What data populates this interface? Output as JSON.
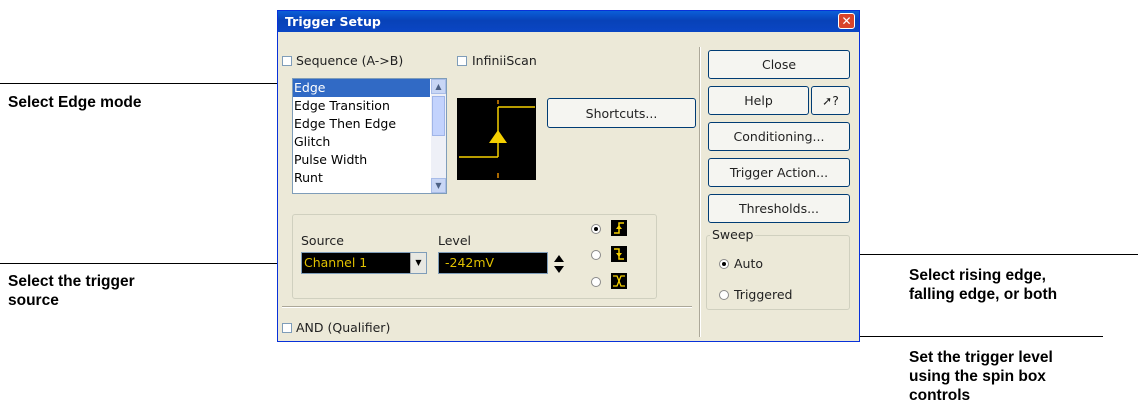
{
  "dialog": {
    "title": "Trigger Setup",
    "sequence_label": "Sequence (A->B)",
    "infiniiscan_label": "InfiniiScan",
    "trigger_modes": [
      "Edge",
      "Edge Transition",
      "Edge Then Edge",
      "Glitch",
      "Pulse Width",
      "Runt"
    ],
    "selected_mode": "Edge",
    "shortcuts_label": "Shortcuts...",
    "source_label": "Source",
    "source_value": "Channel 1",
    "level_label": "Level",
    "level_value": "-242mV",
    "and_qualifier_label": "AND (Qualifier)",
    "buttons": {
      "close": "Close",
      "help": "Help",
      "whats_this": "?",
      "conditioning": "Conditioning...",
      "trigger_action": "Trigger Action...",
      "thresholds": "Thresholds..."
    },
    "sweep": {
      "label": "Sweep",
      "auto": "Auto",
      "triggered": "Triggered",
      "selected": "Auto"
    },
    "edge_selected": "rising"
  },
  "callouts": {
    "edge_mode": "Select Edge mode",
    "trigger_source_line1": "Select the trigger",
    "trigger_source_line2": "source",
    "edge_select_line1": "Select rising edge,",
    "edge_select_line2": "falling edge, or both",
    "level_line1": "Set the trigger level",
    "level_line2": "using the spin box",
    "level_line3": "controls"
  },
  "colors": {
    "title_bar": "#0a50cc",
    "selection": "#316ac5",
    "readout_text": "#e0c000",
    "dialog_bg": "#ece9d8"
  }
}
